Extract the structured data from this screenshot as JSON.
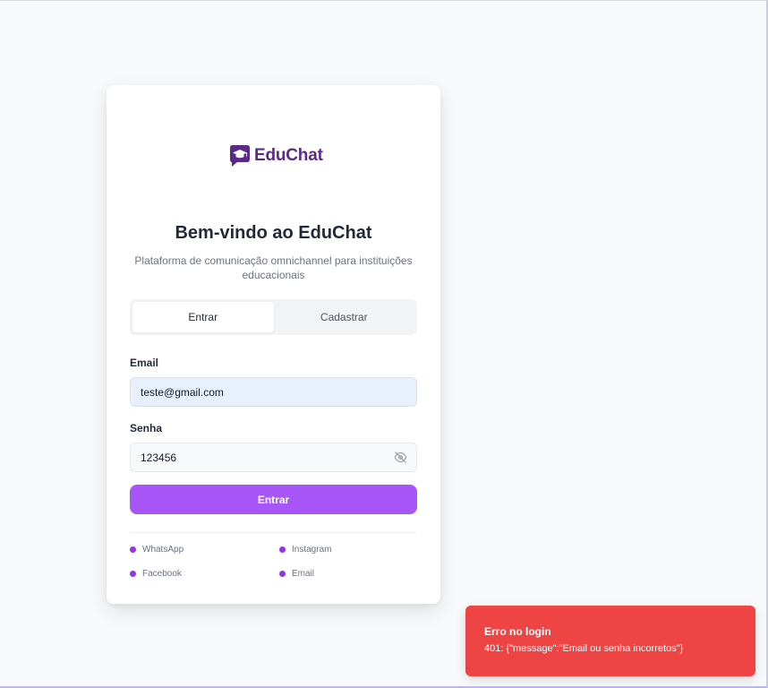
{
  "brand": {
    "name": "EduChat",
    "color": "#5b2a86",
    "icon": "graduation-chat-icon"
  },
  "welcome": {
    "title": "Bem-vindo ao EduChat",
    "subtitle": "Plataforma de comunicação omnichannel para instituições educacionais"
  },
  "tabs": [
    {
      "label": "Entrar",
      "active": true
    },
    {
      "label": "Cadastrar",
      "active": false
    }
  ],
  "form": {
    "email_label": "Email",
    "email_value": "teste@gmail.com",
    "password_label": "Senha",
    "password_value": "123456",
    "password_toggle_icon": "eye-off-icon",
    "submit_label": "Entrar"
  },
  "channels": [
    "WhatsApp",
    "Instagram",
    "Facebook",
    "Email"
  ],
  "toast": {
    "title": "Erro no login",
    "message": "401: {\"message\":\"Email ou senha incorretos\"}"
  },
  "colors": {
    "accent": "#a855f7",
    "channel_dot": "#9333ea",
    "error": "#ef4444",
    "autofill_bg": "#e8f0fe"
  }
}
